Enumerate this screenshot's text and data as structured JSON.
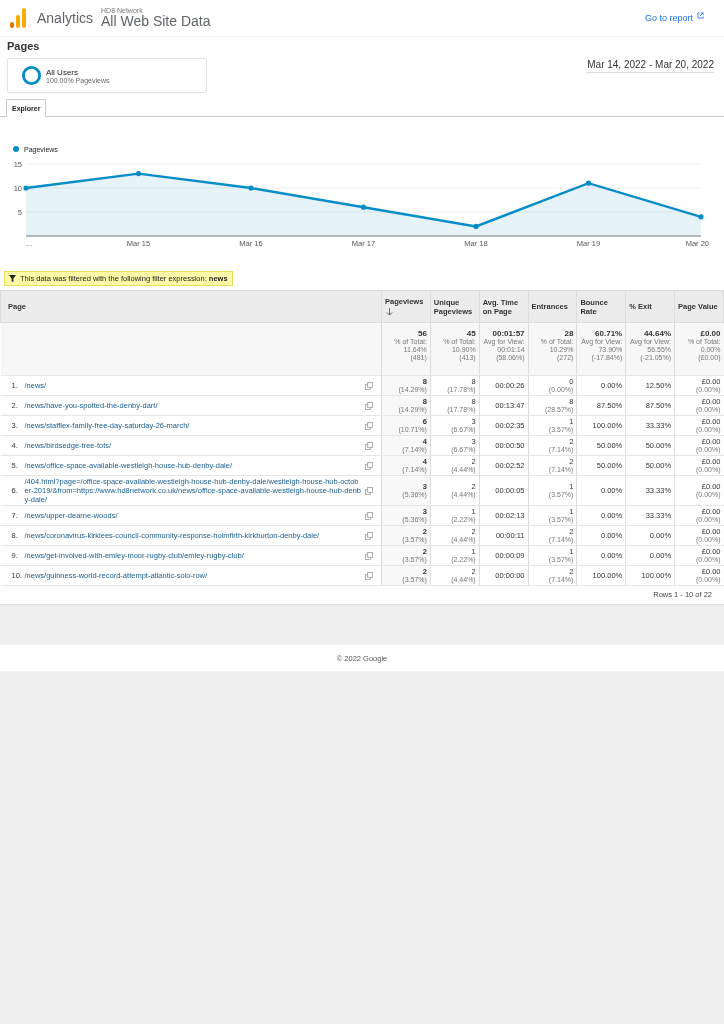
{
  "header": {
    "product": "Analytics",
    "account": "HD8 Network",
    "property": "All Web Site Data",
    "link": "Go to report"
  },
  "page_title": "Pages",
  "segment": {
    "name": "All Users",
    "detail": "100.00% Pageviews"
  },
  "date_range": "Mar 14, 2022 - Mar 20, 2022",
  "tabs": [
    {
      "label": "Explorer",
      "selected": true
    }
  ],
  "chart": {
    "chart_data": {
      "type": "area",
      "categories": [
        "...",
        "Mar 15",
        "Mar 16",
        "Mar 17",
        "Mar 18",
        "Mar 19",
        "Mar 20"
      ],
      "ylim": [
        0,
        15
      ],
      "yticks": [
        5,
        10,
        15
      ],
      "series": [
        {
          "name": "Pageviews",
          "color": "#058dc7",
          "values": [
            10,
            13,
            10,
            6,
            2,
            11,
            4
          ]
        }
      ]
    }
  },
  "filter": "This data was filtered with the following filter expression: **news**",
  "table": {
    "columns": [
      {
        "label": "Page",
        "sorted": false
      },
      {
        "label": "Pageviews",
        "sorted": true
      },
      {
        "label": "Unique Pageviews",
        "sorted": false
      },
      {
        "label": "Avg. Time on Page",
        "sorted": false
      },
      {
        "label": "Entrances",
        "sorted": false
      },
      {
        "label": "Bounce Rate",
        "sorted": false
      },
      {
        "label": "% Exit",
        "sorted": false
      },
      {
        "label": "Page Value",
        "sorted": false
      }
    ],
    "totals": {
      "cells": [
        "",
        {
          "value": "56",
          "note": [
            "% of Total:",
            "11.64%",
            "(481)"
          ]
        },
        {
          "value": "45",
          "note": [
            "% of Total:",
            "10.90%",
            "(413)"
          ]
        },
        {
          "value": "00:01:57",
          "note": [
            "Avg for View:",
            "00:01:14",
            "(58.06%)"
          ]
        },
        {
          "value": "28",
          "note": [
            "% of Total:",
            "10.29%",
            "(272)"
          ]
        },
        {
          "value": "60.71%",
          "note": [
            "Avg for View:",
            "73.90%",
            "(-17.84%)"
          ]
        },
        {
          "value": "44.64%",
          "note": [
            "Avg for View:",
            "56.55%",
            "(-21.05%)"
          ]
        },
        {
          "value": "£0.00",
          "note": [
            "% of Total:",
            "0.00%",
            "(£0.00)"
          ]
        }
      ]
    },
    "rows": [
      {
        "cells": [
          {
            "index": "1.",
            "page": "/news/"
          },
          {
            "value": "8",
            "note": "(14.29%)"
          },
          {
            "value": "8",
            "note": "(17.78%)"
          },
          {
            "value": "00:00:26"
          },
          {
            "value": "0",
            "note": "(0.00%)"
          },
          {
            "value": "0.00%"
          },
          {
            "value": "12.50%"
          },
          {
            "value": "£0.00",
            "note": "(0.00%)"
          }
        ]
      },
      {
        "cells": [
          {
            "index": "2.",
            "page": "/news/have-you-spotted-the-denby-dart/"
          },
          {
            "value": "8",
            "note": "(14.29%)"
          },
          {
            "value": "8",
            "note": "(17.78%)"
          },
          {
            "value": "00:13:47"
          },
          {
            "value": "8",
            "note": "(28.57%)"
          },
          {
            "value": "87.50%"
          },
          {
            "value": "87.50%"
          },
          {
            "value": "£0.00",
            "note": "(0.00%)"
          }
        ]
      },
      {
        "cells": [
          {
            "index": "3.",
            "page": "/news/stafflex-family-free-day-saturday-26-march/"
          },
          {
            "value": "6",
            "note": "(10.71%)"
          },
          {
            "value": "3",
            "note": "(6.67%)"
          },
          {
            "value": "00:02:35"
          },
          {
            "value": "1",
            "note": "(3.57%)"
          },
          {
            "value": "100.00%"
          },
          {
            "value": "33.33%"
          },
          {
            "value": "£0.00",
            "note": "(0.00%)"
          }
        ]
      },
      {
        "cells": [
          {
            "index": "4.",
            "page": "/news/birdsedge-tree-tots/"
          },
          {
            "value": "4",
            "note": "(7.14%)"
          },
          {
            "value": "3",
            "note": "(6.67%)"
          },
          {
            "value": "00:00:50"
          },
          {
            "value": "2",
            "note": "(7.14%)"
          },
          {
            "value": "50.00%"
          },
          {
            "value": "50.00%"
          },
          {
            "value": "£0.00",
            "note": "(0.00%)"
          }
        ]
      },
      {
        "cells": [
          {
            "index": "5.",
            "page": "/news/office-space-available-westleigh-house-hub-denby-dale/"
          },
          {
            "value": "4",
            "note": "(7.14%)"
          },
          {
            "value": "2",
            "note": "(4.44%)"
          },
          {
            "value": "00:02:52"
          },
          {
            "value": "2",
            "note": "(7.14%)"
          },
          {
            "value": "50.00%"
          },
          {
            "value": "50.00%"
          },
          {
            "value": "£0.00",
            "note": "(0.00%)"
          }
        ]
      },
      {
        "cells": [
          {
            "index": "6.",
            "page": "/404.html?page=/office-space-available-westleigh-house-hub-denby-dale/westleigh-house-hub-october-2019/&from=https://www.hd8network.co.uk/news/office-space-available-westleigh-house-hub-denby-dale/"
          },
          {
            "value": "3",
            "note": "(5.36%)"
          },
          {
            "value": "2",
            "note": "(4.44%)"
          },
          {
            "value": "00:00:05"
          },
          {
            "value": "1",
            "note": "(3.57%)"
          },
          {
            "value": "0.00%"
          },
          {
            "value": "33.33%"
          },
          {
            "value": "£0.00",
            "note": "(0.00%)"
          }
        ]
      },
      {
        "cells": [
          {
            "index": "7.",
            "page": "/news/upper-dearne-woods/"
          },
          {
            "value": "3",
            "note": "(5.36%)"
          },
          {
            "value": "1",
            "note": "(2.22%)"
          },
          {
            "value": "00:02:13"
          },
          {
            "value": "1",
            "note": "(3.57%)"
          },
          {
            "value": "0.00%"
          },
          {
            "value": "33.33%"
          },
          {
            "value": "£0.00",
            "note": "(0.00%)"
          }
        ]
      },
      {
        "cells": [
          {
            "index": "8.",
            "page": "/news/coronavirus-kirklees-council-community-response-holmfirth-kirkburton-denby-dale/"
          },
          {
            "value": "2",
            "note": "(3.57%)"
          },
          {
            "value": "2",
            "note": "(4.44%)"
          },
          {
            "value": "00:00:11"
          },
          {
            "value": "2",
            "note": "(7.14%)"
          },
          {
            "value": "0.00%"
          },
          {
            "value": "0.00%"
          },
          {
            "value": "£0.00",
            "note": "(0.00%)"
          }
        ]
      },
      {
        "cells": [
          {
            "index": "9.",
            "page": "/news/get-involved-with-emley-moor-rugby-club/emley-rugby-club/"
          },
          {
            "value": "2",
            "note": "(3.57%)"
          },
          {
            "value": "1",
            "note": "(2.22%)"
          },
          {
            "value": "00:00:09"
          },
          {
            "value": "1",
            "note": "(3.57%)"
          },
          {
            "value": "0.00%"
          },
          {
            "value": "0.00%"
          },
          {
            "value": "£0.00",
            "note": "(0.00%)"
          }
        ]
      },
      {
        "cells": [
          {
            "index": "10.",
            "page": "/news/guinness-world-record-attempt-atlantic-solo-row/"
          },
          {
            "value": "2",
            "note": "(3.57%)"
          },
          {
            "value": "2",
            "note": "(4.44%)"
          },
          {
            "value": "00:00:00"
          },
          {
            "value": "2",
            "note": "(7.14%)"
          },
          {
            "value": "100.00%"
          },
          {
            "value": "100.00%"
          },
          {
            "value": "£0.00",
            "note": "(0.00%)"
          }
        ]
      }
    ],
    "pagination": "Rows 1 - 10 of 22"
  },
  "copyright": "© 2022 Google"
}
